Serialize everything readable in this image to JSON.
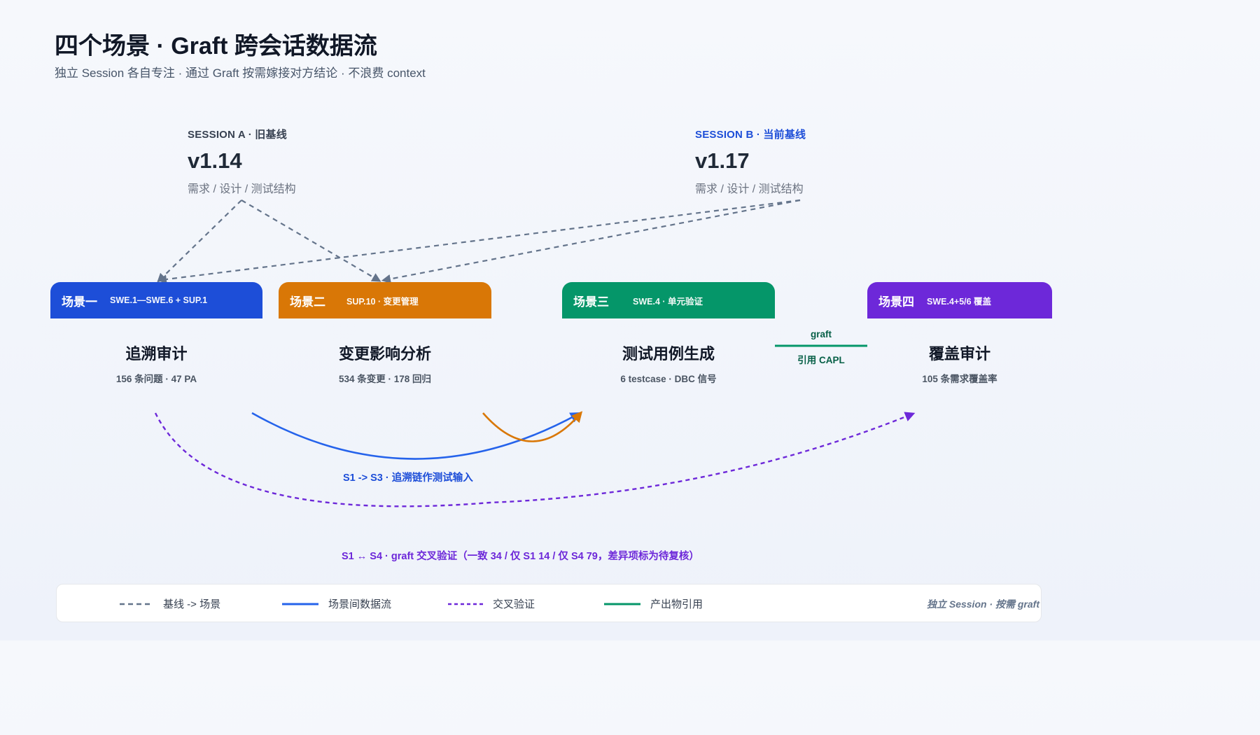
{
  "header": {
    "title": "四个场景 · Graft 跨会话数据流",
    "subtitle": "独立 Session 各自专注 · 通过 Graft 按需嫁接对方结论 · 不浪费 context"
  },
  "sessions": {
    "a": {
      "label": "SESSION A · 旧基线",
      "version": "v1.14",
      "desc": "需求 / 设计 / 测试结构"
    },
    "b": {
      "label": "SESSION B · 当前基线",
      "version": "v1.17",
      "desc": "需求 / 设计 / 测试结构"
    }
  },
  "scenes": [
    {
      "tab_title": "场景一",
      "tab_code": "SWE.1—SWE.6 + SUP.1",
      "name": "追溯审计",
      "stat": "156 条问题 · 47 PA",
      "color": "#1d4ed8"
    },
    {
      "tab_title": "场景二",
      "tab_code": "SUP.10 · 变更管理",
      "name": "变更影响分析",
      "stat": "534 条变更 · 178 回归",
      "color": "#d97706"
    },
    {
      "tab_title": "场景三",
      "tab_code": "SWE.4 · 单元验证",
      "name": "测试用例生成",
      "stat": "6 testcase · DBC 信号",
      "color": "#059669"
    },
    {
      "tab_title": "场景四",
      "tab_code": "SWE.4+5/6 覆盖",
      "name": "覆盖审计",
      "stat": "105 条需求覆盖率",
      "color": "#6d28d9"
    }
  ],
  "graft_link": {
    "top": "graft",
    "bottom": "引用 CAPL"
  },
  "flows": {
    "s1_s3": "S1 -> S3 · 追溯链作测试输入",
    "s1_s4": "S1 ↔ S4 · graft 交叉验证（一致 34 / 仅 S1 14 / 仅 S4 79，差异项标为待复核）"
  },
  "colors": {
    "baseline": "#64748b",
    "dataflow": "#2563eb",
    "orange_flow": "#d97706",
    "crosscheck": "#6d28d9",
    "artifact": "#059669"
  },
  "legend": {
    "items": [
      {
        "label": "基线 -> 场景"
      },
      {
        "label": "场景间数据流"
      },
      {
        "label": "交叉验证"
      },
      {
        "label": "产出物引用"
      }
    ],
    "note": "独立 Session · 按需 graft"
  }
}
